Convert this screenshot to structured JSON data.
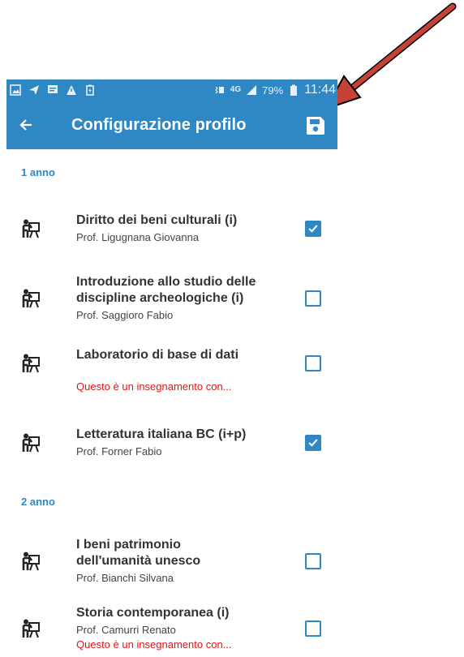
{
  "statusbar": {
    "network": "4G",
    "battery": "79%",
    "time": "11:44",
    "left_icons": [
      "image-icon",
      "send-icon",
      "message-icon",
      "warning-icon",
      "battery-saver-icon"
    ]
  },
  "appbar": {
    "title": "Configurazione profilo",
    "back_icon": "arrow-back-icon",
    "save_icon": "save-icon"
  },
  "sections": [
    {
      "label": "1 anno",
      "courses": [
        {
          "name_lines": [
            "Diritto dei beni culturali (i)"
          ],
          "prof": "Prof. Ligugnana Giovanna",
          "note": "",
          "checked": true
        },
        {
          "name_lines": [
            "Introduzione allo studio delle",
            "discipline archeologiche (i)"
          ],
          "prof": "Prof. Saggioro Fabio",
          "note": "",
          "checked": false
        },
        {
          "name_lines": [
            "Laboratorio di base di dati"
          ],
          "prof": "",
          "note": "Questo è un insegnamento con...",
          "checked": false
        },
        {
          "name_lines": [
            "Letteratura italiana BC (i+p)"
          ],
          "prof": "Prof. Forner Fabio",
          "note": "",
          "checked": true
        }
      ]
    },
    {
      "label": "2 anno",
      "courses": [
        {
          "name_lines": [
            "I beni patrimonio",
            "dell'umanità unesco"
          ],
          "prof": "Prof. Bianchi Silvana",
          "note": "",
          "checked": false
        },
        {
          "name_lines": [
            "Storia contemporanea (i)"
          ],
          "prof": "Prof. Camurri Renato",
          "note": "Questo è un insegnamento con...",
          "checked": false
        }
      ]
    }
  ],
  "colors": {
    "primary": "#2f87c4",
    "warning": "#e01616",
    "annotation_arrow": "#c0392b"
  }
}
